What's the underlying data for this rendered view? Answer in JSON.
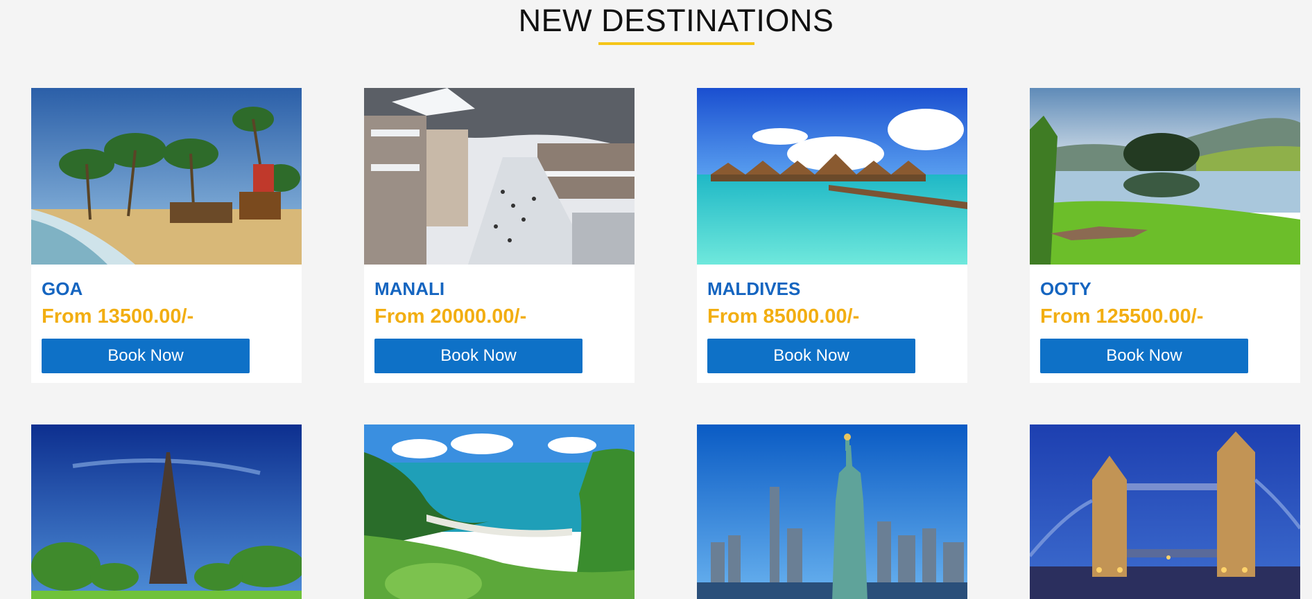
{
  "section": {
    "title": "NEW DESTINATIONS"
  },
  "colors": {
    "accent": "#f5c518",
    "name": "#1565c0",
    "price": "#f2ae12",
    "button": "#0e71c7"
  },
  "destinations": [
    {
      "name": "GOA",
      "price": "From 13500.00/-",
      "button": "Book Now",
      "image": "goa-beach-image"
    },
    {
      "name": "MANALI",
      "price": "From 20000.00/-",
      "button": "Book Now",
      "image": "manali-snow-town-image"
    },
    {
      "name": "MALDIVES",
      "price": "From 85000.00/-",
      "button": "Book Now",
      "image": "maldives-water-villas-image"
    },
    {
      "name": "OOTY",
      "price": "From 125500.00/-",
      "button": "Book Now",
      "image": "ooty-lake-image"
    }
  ],
  "more_destinations": [
    {
      "image": "eiffel-tower-image"
    },
    {
      "image": "tropical-cove-image"
    },
    {
      "image": "statue-of-liberty-image"
    },
    {
      "image": "tower-bridge-image"
    }
  ]
}
